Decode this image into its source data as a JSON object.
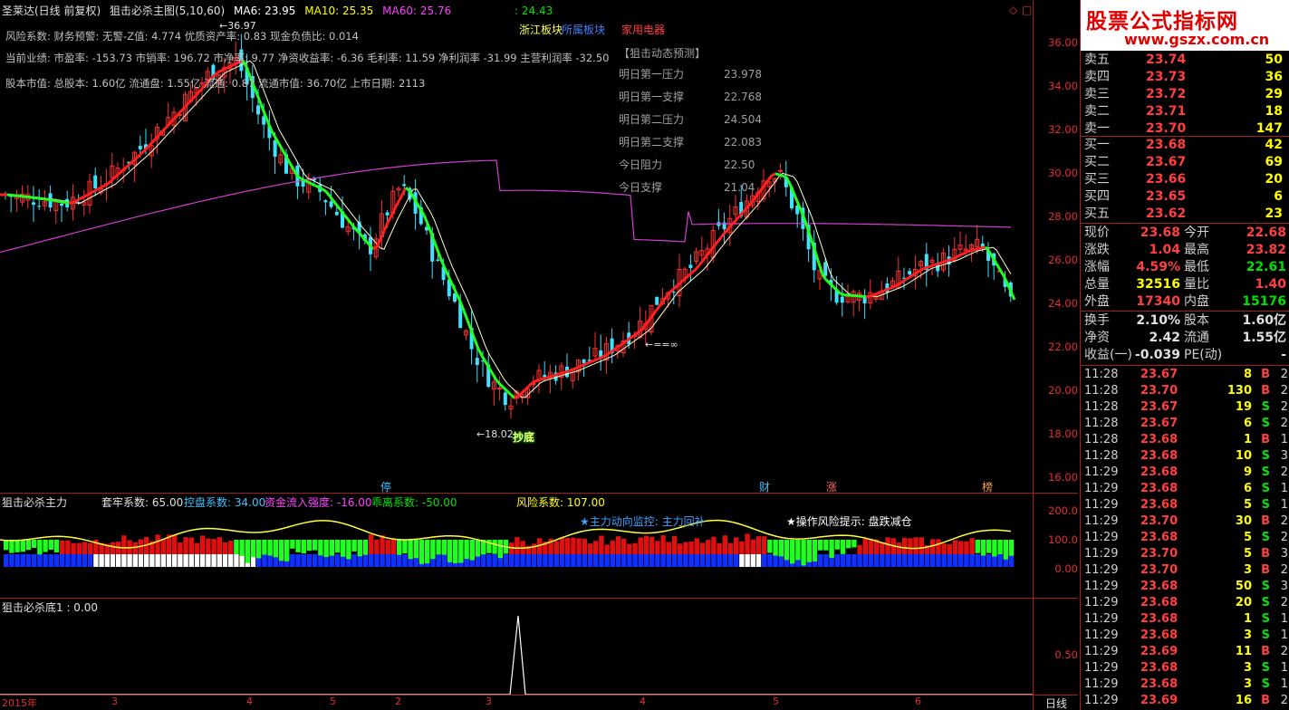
{
  "header": {
    "stock_title": "圣莱达(日线 前复权)",
    "indicator_title": "狙击必杀主图(5,10,60)",
    "ma6": "MA6: 23.95",
    "ma10": "MA10: 25.35",
    "ma60": "MA60: 25.76",
    "extra": ": 24.43"
  },
  "info_lines": [
    "风险系数: 财务预警: 无警-Z值: 4.774 优质资产率: 0.83 现金负债比: 0.014",
    "当前业绩: 市盈率: -153.73 市销率: 196.72 市净率: 9.77 净资收益率: -6.36 毛利率: 11.59 净利润率 -31.99 主营利润率 -32.50",
    "股本市值: 总股本: 1.60亿 流通盘: 1.55亿 流通: 0.87 流通市值: 36.70亿 上市日期: 2113"
  ],
  "sectors": [
    "浙江板块",
    "所属板块",
    "家用电器"
  ],
  "prediction": {
    "title": "【狙击动态预测】",
    "rows": [
      {
        "label": "明日第一压力",
        "value": "23.978"
      },
      {
        "label": "明日第一支撑",
        "value": "22.768"
      },
      {
        "label": "明日第二压力",
        "value": "24.504"
      },
      {
        "label": "明日第二支撑",
        "value": "22.083"
      },
      {
        "label": "今日阻力",
        "value": "22.50"
      },
      {
        "label": "今日支撑",
        "value": "21.04"
      }
    ]
  },
  "chart_annotations": {
    "high_label": "←36.97",
    "low_label": "←18.02",
    "equal_label": "←==∞",
    "signal_text": "抄底",
    "markers": [
      "停",
      "财",
      "涨",
      "榜"
    ]
  },
  "price_axis": [
    "36.00",
    "34.00",
    "32.00",
    "30.00",
    "28.00",
    "26.00",
    "24.00",
    "22.00",
    "20.00",
    "18.00",
    "16.00"
  ],
  "sub1": {
    "title": "狙击必杀主力",
    "params": [
      {
        "text": "套牢系数: 65.00",
        "color": "#e0e0e0"
      },
      {
        "text": "控盘系数: 34.00",
        "color": "#40c0ff"
      },
      {
        "text": "资金流入强度: -16.00",
        "color": "#ff40ff"
      },
      {
        "text": "乖离系数: -50.00",
        "color": "#00e000"
      },
      {
        "text": "风险系数: 107.00",
        "color": "#ffff00"
      }
    ],
    "notes": [
      "★主力动向监控: 主力回补",
      "★操作风险提示: 盘跌减仓"
    ],
    "axis": [
      "200.0",
      "100.0",
      "0.00"
    ]
  },
  "sub2": {
    "title": "狙击必杀底1 : 0.00",
    "axis": [
      "0.50"
    ]
  },
  "dates": [
    "2015年",
    "3",
    "4",
    "5",
    "2",
    "3",
    "4",
    "5",
    "6"
  ],
  "period_label": "日线",
  "logo": {
    "title": "股票公式指标网",
    "url": "www.gszx.com.cn"
  },
  "order_book": {
    "asks": [
      {
        "name": "卖五",
        "price": "23.74",
        "qty": "50"
      },
      {
        "name": "卖四",
        "price": "23.73",
        "qty": "36"
      },
      {
        "name": "卖三",
        "price": "23.72",
        "qty": "29"
      },
      {
        "name": "卖二",
        "price": "23.71",
        "qty": "18"
      },
      {
        "name": "卖一",
        "price": "23.70",
        "qty": "147"
      }
    ],
    "bids": [
      {
        "name": "买一",
        "price": "23.68",
        "qty": "42"
      },
      {
        "name": "买二",
        "price": "23.67",
        "qty": "69"
      },
      {
        "name": "买三",
        "price": "23.66",
        "qty": "20"
      },
      {
        "name": "买四",
        "price": "23.65",
        "qty": "6"
      },
      {
        "name": "买五",
        "price": "23.62",
        "qty": "23"
      }
    ]
  },
  "stats": [
    {
      "l1": "现价",
      "v1": "23.68",
      "c1": "red",
      "l2": "今开",
      "v2": "22.68",
      "c2": "red"
    },
    {
      "l1": "涨跌",
      "v1": "1.04",
      "c1": "red",
      "l2": "最高",
      "v2": "23.82",
      "c2": "red"
    },
    {
      "l1": "涨幅",
      "v1": "4.59%",
      "c1": "red",
      "l2": "最低",
      "v2": "22.61",
      "c2": "green"
    },
    {
      "l1": "总量",
      "v1": "32516",
      "c1": "yellow",
      "l2": "量比",
      "v2": "1.40",
      "c2": "red"
    },
    {
      "l1": "外盘",
      "v1": "17340",
      "c1": "red",
      "l2": "内盘",
      "v2": "15176",
      "c2": "green"
    }
  ],
  "stats2": [
    {
      "l1": "换手",
      "v1": "2.10%",
      "c1": "white",
      "l2": "股本",
      "v2": "1.60亿",
      "c2": "white"
    },
    {
      "l1": "净资",
      "v1": "2.42",
      "c1": "white",
      "l2": "流通",
      "v2": "1.55亿",
      "c2": "white"
    },
    {
      "l1": "收益(一)",
      "v1": "-0.039",
      "c1": "white",
      "l2": "PE(动)",
      "v2": "-",
      "c2": "white"
    }
  ],
  "ticks": [
    {
      "t": "11:28",
      "p": "23.67",
      "q": "8",
      "s": "B",
      "c": "2"
    },
    {
      "t": "11:28",
      "p": "23.70",
      "q": "130",
      "s": "B",
      "c": "2"
    },
    {
      "t": "11:28",
      "p": "23.67",
      "q": "19",
      "s": "S",
      "c": "2"
    },
    {
      "t": "11:28",
      "p": "23.67",
      "q": "6",
      "s": "S",
      "c": "2"
    },
    {
      "t": "11:28",
      "p": "23.68",
      "q": "1",
      "s": "B",
      "c": "1"
    },
    {
      "t": "11:28",
      "p": "23.68",
      "q": "10",
      "s": "S",
      "c": "3"
    },
    {
      "t": "11:29",
      "p": "23.68",
      "q": "9",
      "s": "S",
      "c": "2"
    },
    {
      "t": "11:29",
      "p": "23.68",
      "q": "6",
      "s": "S",
      "c": "1"
    },
    {
      "t": "11:29",
      "p": "23.68",
      "q": "5",
      "s": "S",
      "c": "1"
    },
    {
      "t": "11:29",
      "p": "23.70",
      "q": "30",
      "s": "B",
      "c": "2"
    },
    {
      "t": "11:29",
      "p": "23.68",
      "q": "5",
      "s": "S",
      "c": "2"
    },
    {
      "t": "11:29",
      "p": "23.70",
      "q": "5",
      "s": "B",
      "c": "3"
    },
    {
      "t": "11:29",
      "p": "23.70",
      "q": "3",
      "s": "B",
      "c": "2"
    },
    {
      "t": "11:29",
      "p": "23.68",
      "q": "50",
      "s": "S",
      "c": "3"
    },
    {
      "t": "11:29",
      "p": "23.68",
      "q": "20",
      "s": "S",
      "c": "2"
    },
    {
      "t": "11:29",
      "p": "23.68",
      "q": "1",
      "s": "S",
      "c": "1"
    },
    {
      "t": "11:29",
      "p": "23.68",
      "q": "3",
      "s": "S",
      "c": "1"
    },
    {
      "t": "11:29",
      "p": "23.69",
      "q": "11",
      "s": "B",
      "c": "2"
    },
    {
      "t": "11:29",
      "p": "23.68",
      "q": "3",
      "s": "S",
      "c": "1"
    },
    {
      "t": "11:29",
      "p": "23.68",
      "q": "3",
      "s": "S",
      "c": "1"
    },
    {
      "t": "11:29",
      "p": "23.69",
      "q": "16",
      "s": "B",
      "c": "2"
    }
  ]
}
